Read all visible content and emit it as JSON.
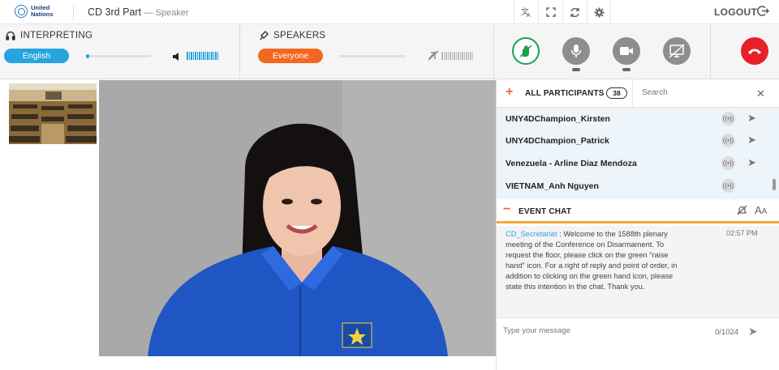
{
  "app": {
    "logo_text": "United Nations",
    "meeting_title": "CD 3rd Part",
    "meeting_role": "— Speaker"
  },
  "topbar": {
    "icons": [
      "translate-icon",
      "fullscreen-icon",
      "refresh-icon",
      "gear-icon"
    ],
    "logout_label": "LOGOUT"
  },
  "interpreting": {
    "label": "INTERPRETING",
    "language": "English",
    "volume_level": 0.05
  },
  "speakers": {
    "label": "SPEAKERS",
    "selection": "Everyone",
    "volume_level": 0.0,
    "muted": true
  },
  "actions": {
    "raise_hand": "raise-hand-icon",
    "microphone": "microphone-icon",
    "camera": "camera-icon",
    "screen_share": "screen-share-off-icon",
    "hangup": "hangup-icon"
  },
  "participants": {
    "title": "ALL PARTICIPANTS",
    "count": "38",
    "search_placeholder": "Search",
    "list": [
      {
        "name": "UNY4DChampion_Kirsten"
      },
      {
        "name": "UNY4DChampion_Patrick"
      },
      {
        "name": "Venezuela - Arline Diaz Mendoza"
      },
      {
        "name": "VIETNAM_Anh Nguyen"
      }
    ]
  },
  "event_chat": {
    "title": "EVENT CHAT",
    "messages": [
      {
        "sender": "CD_Secretariat",
        "separator": " :  ",
        "text": "Welcome to the 1588th plenary meeting of the Conference on Disarmament. To request the floor, please click on the green “raise hand” icon. For a right of reply and point of order, in addition to clicking on the green hand icon, please state this intention in the chat. Thank you.",
        "time": "02:57 PM"
      }
    ],
    "input_placeholder": "Type your message",
    "char_count": "0/1024"
  },
  "colors": {
    "accent_blue": "#27a3e0",
    "accent_orange": "#f26722",
    "raise_hand_green": "#1e9e53",
    "hangup_red": "#e8202a"
  }
}
